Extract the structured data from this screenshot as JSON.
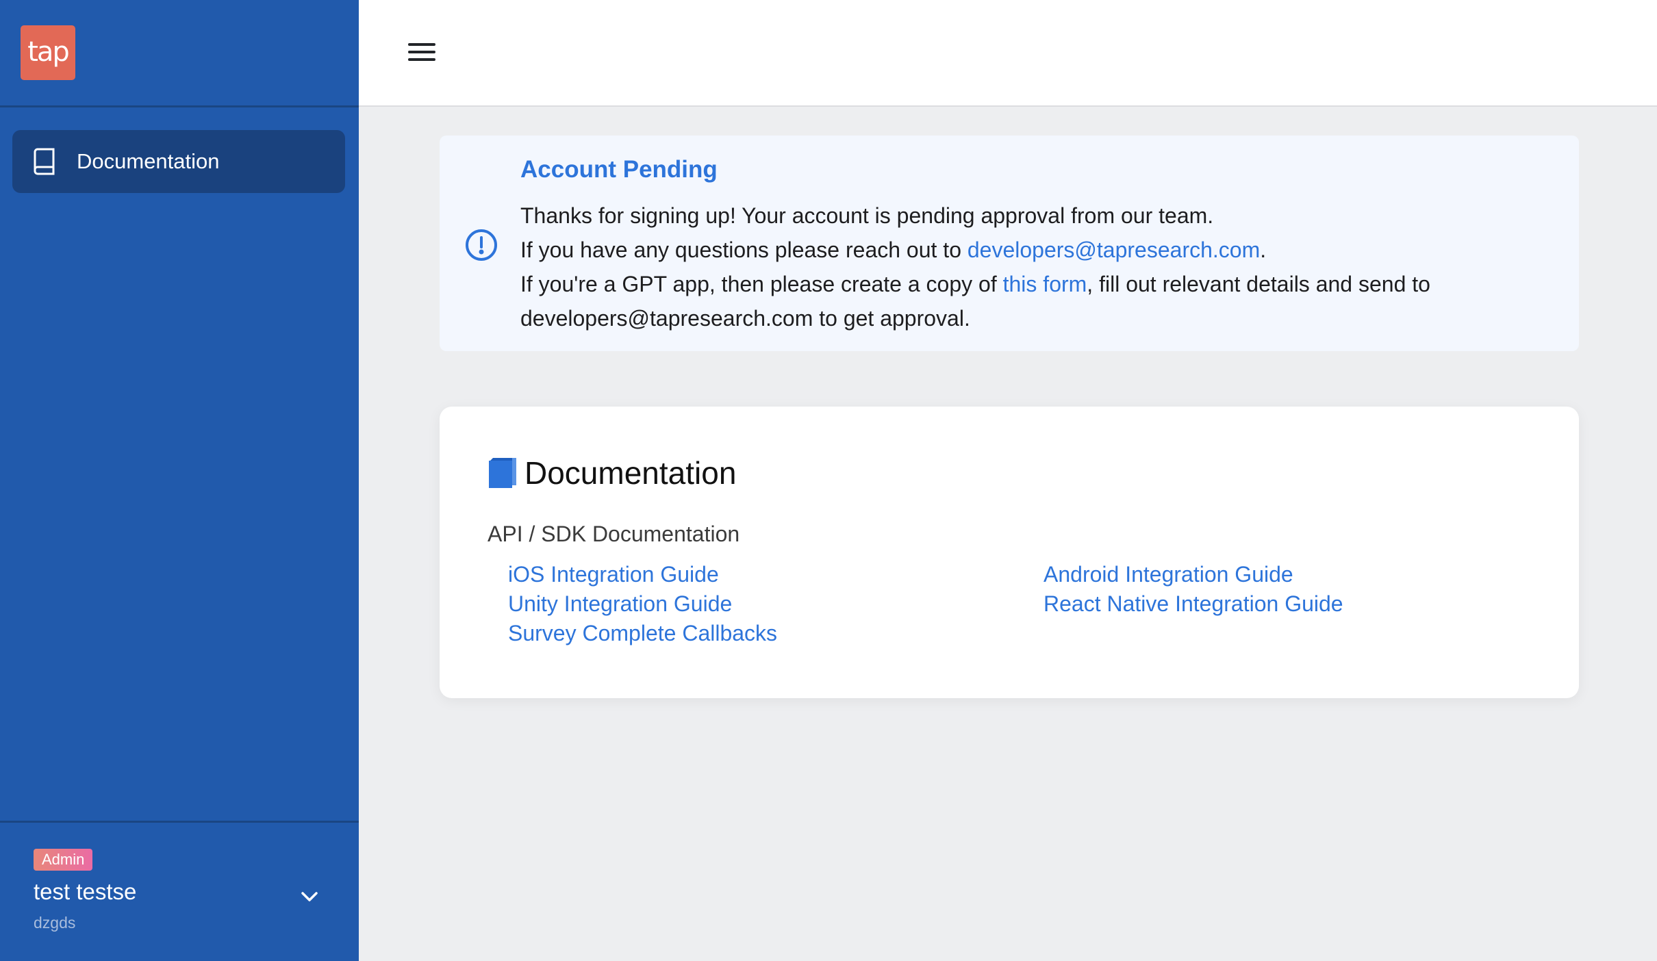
{
  "brand": {
    "logo_text": "tap",
    "logo_color": "#e26956"
  },
  "sidebar": {
    "items": [
      {
        "label": "Documentation",
        "icon": "book-icon",
        "active": true
      }
    ],
    "user": {
      "role_badge": "Admin",
      "name": "test testse",
      "org": "dzgds"
    }
  },
  "header": {
    "menu_icon": "hamburger-icon"
  },
  "alert": {
    "icon": "exclamation-circle-icon",
    "title": "Account Pending",
    "line1": "Thanks for signing up! Your account is pending approval from our team.",
    "line2_prefix": "If you have any questions please reach out to ",
    "line2_link": "developers@tapresearch.com",
    "line2_suffix": ".",
    "line3_prefix": "If you're a GPT app, then please create a copy of ",
    "line3_link": "this form",
    "line3_suffix": ", fill out relevant details and send to developers@tapresearch.com to get approval."
  },
  "documentation": {
    "title": "Documentation",
    "icon": "blue-book-icon",
    "subtitle": "API / SDK Documentation",
    "links_left": [
      "iOS Integration Guide",
      "Unity Integration Guide",
      "Survey Complete Callbacks"
    ],
    "links_right": [
      "Android Integration Guide",
      "React Native Integration Guide"
    ]
  },
  "colors": {
    "sidebar": "#215aac",
    "sidebar_active": "#1a427e",
    "accent": "#2d74da",
    "background": "#edeef0"
  }
}
